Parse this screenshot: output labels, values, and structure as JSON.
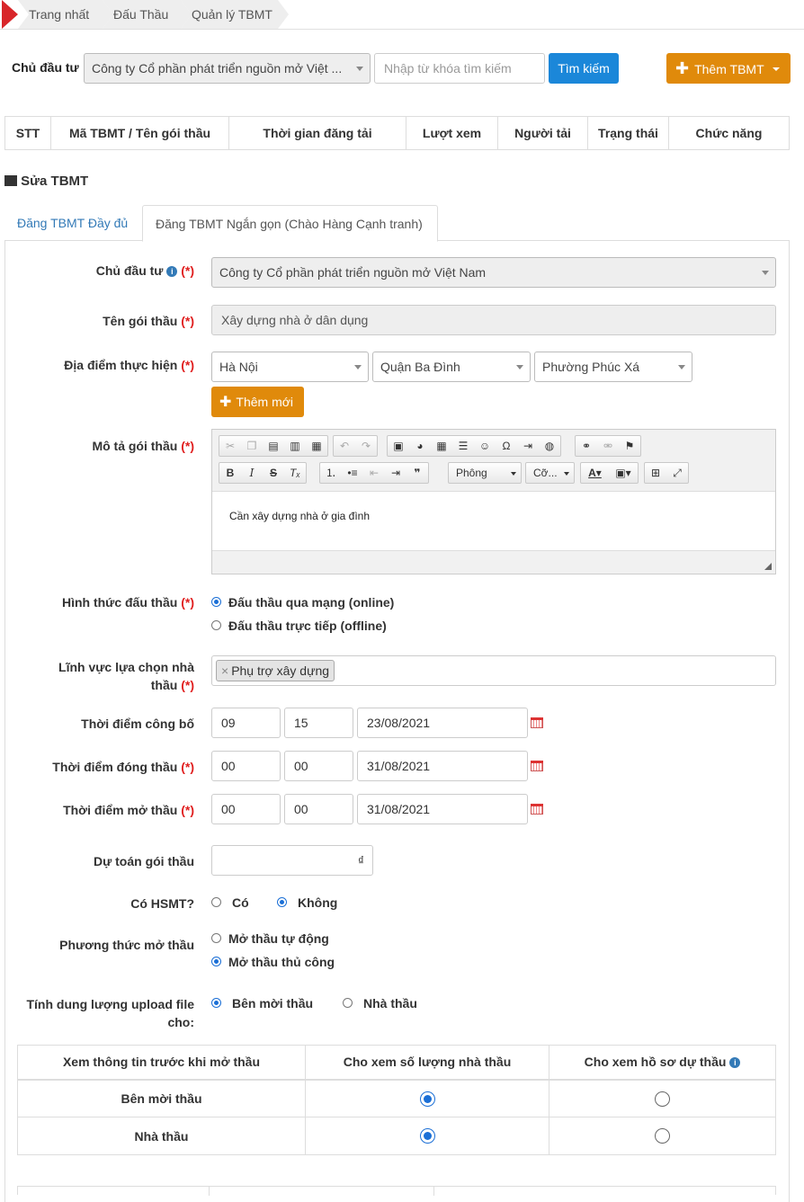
{
  "breadcrumb": [
    "Trang nhất",
    "Đấu Thầu",
    "Quản lý TBMT"
  ],
  "filter": {
    "investor_label": "Chủ đầu tư",
    "investor_value": "Công ty Cổ phần phát triển nguồn mở Việt ...",
    "keyword_placeholder": "Nhập từ khóa tìm kiếm",
    "search_label": "Tìm kiếm",
    "add_label": "Thêm TBMT"
  },
  "list_columns": [
    "STT",
    "Mã TBMT / Tên gói thầu",
    "Thời gian đăng tải",
    "Lượt xem",
    "Người tải",
    "Trạng thái",
    "Chức năng"
  ],
  "section_title": "Sửa TBMT",
  "tabs": [
    "Đăng TBMT Đầy đủ",
    "Đăng TBMT Ngắn gọn (Chào Hàng Cạnh tranh)"
  ],
  "form": {
    "investor": {
      "label": "Chủ đầu tư",
      "value": "Công ty Cổ phần phát triển nguồn mở Việt Nam"
    },
    "package_name": {
      "label": "Tên gói thầu",
      "value": "Xây dựng nhà ở dân dụng"
    },
    "location": {
      "label": "Địa điểm thực hiện",
      "province": "Hà Nội",
      "district": "Quận Ba Đình",
      "ward": "Phường Phúc Xá",
      "add_label": "Thêm mới"
    },
    "description": {
      "label": "Mô tả gói thầu",
      "content": "Cần xây dựng nhà ở gia đình",
      "font_combo": "Phông",
      "size_combo": "Cỡ..."
    },
    "bid_form": {
      "label": "Hình thức đấu thầu",
      "options": [
        "Đấu thầu qua mạng (online)",
        "Đấu thầu trực tiếp (offline)"
      ],
      "selected": 0
    },
    "field": {
      "label": "Lĩnh vực lựa chọn nhà thầu",
      "tag": "Phụ trợ xây dựng",
      "tag_remove": "×"
    },
    "announce": {
      "label": "Thời điểm công bố",
      "hour": "09",
      "minute": "15",
      "date": "23/08/2021"
    },
    "close": {
      "label": "Thời điểm đóng thầu",
      "hour": "00",
      "minute": "00",
      "date": "31/08/2021"
    },
    "open": {
      "label": "Thời điểm mở thầu",
      "hour": "00",
      "minute": "00",
      "date": "31/08/2021"
    },
    "estimate": {
      "label": "Dự toán gói thầu",
      "value": "",
      "currency": "₫"
    },
    "hsmt": {
      "label": "Có HSMT?",
      "options": [
        "Có",
        "Không"
      ],
      "selected": 1
    },
    "open_method": {
      "label": "Phương thức mở thầu",
      "options": [
        "Mở thầu tự động",
        "Mở thầu thủ công"
      ],
      "selected": 1
    },
    "upload_quota": {
      "label": "Tính dung lượng upload file cho:",
      "options": [
        "Bên mời thầu",
        "Nhà thầu"
      ],
      "selected": 0
    },
    "required_mark": "(*)"
  },
  "view_table": {
    "headers": [
      "Xem thông tin trước khi mở thầu",
      "Cho xem số lượng nhà thầu",
      "Cho xem hồ sơ dự thầu"
    ],
    "rows": [
      {
        "label": "Bên mời thầu",
        "count": true,
        "docs": false
      },
      {
        "label": "Nhà thầu",
        "count": true,
        "docs": false
      }
    ]
  },
  "colors": {
    "primary": "#1b87d9",
    "warning": "#e08a0b",
    "required": "#e02020",
    "brand_red": "#d8262a"
  }
}
